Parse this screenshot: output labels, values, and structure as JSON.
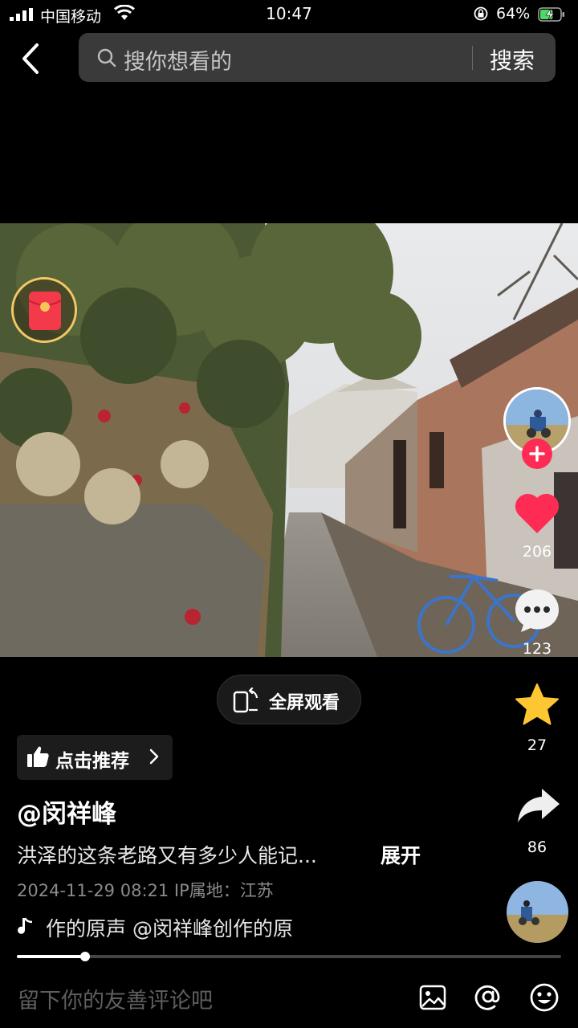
{
  "status_bar": {
    "carrier": "中国移动",
    "time": "10:47",
    "battery": "64%",
    "battery_level": 0.64
  },
  "search": {
    "placeholder": "搜你想看的",
    "button": "搜索"
  },
  "video": {
    "fullscreen_label": "全屏观看",
    "progress": 0.125
  },
  "sidebar": {
    "likes": "206",
    "comments": "123",
    "favorites": "27",
    "shares": "86"
  },
  "post": {
    "recommend_label": "点击推荐",
    "author": "@闵祥峰",
    "description": "洪泽的这条老路又有多少人能记...",
    "expand": "展开",
    "meta": "2024-11-29 08:21  IP属地：江苏",
    "music": "作的原声    @闵祥峰创作的原"
  },
  "comment_bar": {
    "placeholder": "留下你的友善评论吧"
  },
  "colors": {
    "accent": "#fe2c55",
    "favorite": "#fec731",
    "like": "#fe2c55"
  }
}
